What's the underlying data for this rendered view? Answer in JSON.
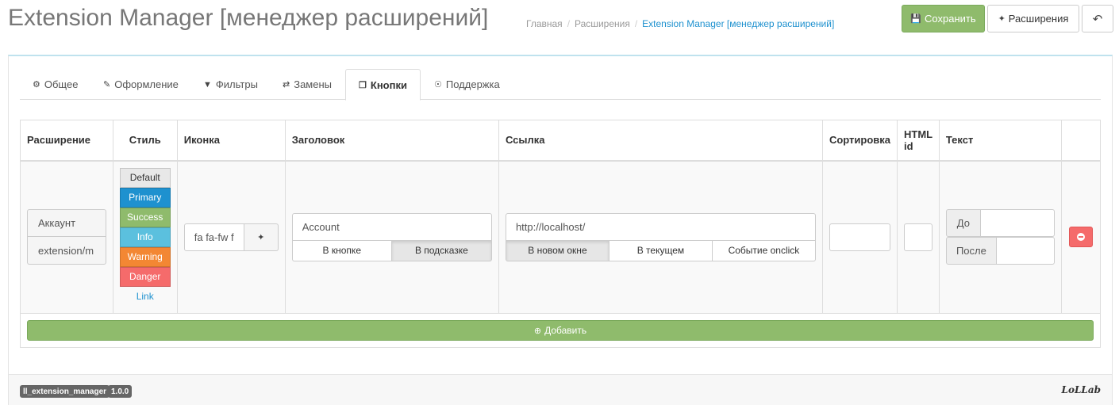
{
  "header": {
    "title": "Extension Manager [менеджер расширений]",
    "breadcrumb": [
      "Главная",
      "Расширения",
      "Extension Manager [менеджер расширений]"
    ],
    "buttons": {
      "save": "Сохранить",
      "extensions": "Расширения"
    },
    "icons": {
      "save": "floppy-icon",
      "extensions": "puzzle-icon",
      "back": "reply-icon"
    }
  },
  "tabs": [
    {
      "label": "Общее",
      "icon": "gear-icon"
    },
    {
      "label": "Оформление",
      "icon": "brush-icon"
    },
    {
      "label": "Фильтры",
      "icon": "filter-icon"
    },
    {
      "label": "Замены",
      "icon": "exchange-icon"
    },
    {
      "label": "Кнопки",
      "icon": "clone-icon",
      "active": true
    },
    {
      "label": "Поддержка",
      "icon": "lifebuoy-icon"
    }
  ],
  "table": {
    "headers": [
      "Расширение",
      "Стиль",
      "Иконка",
      "Заголовок",
      "Ссылка",
      "Сортировка",
      "HTML id",
      "Текст",
      ""
    ],
    "row": {
      "extension_name": "Аккаунт",
      "extension_route": "extension/m",
      "styles": [
        "Default",
        "Primary",
        "Success",
        "Info",
        "Warning",
        "Danger",
        "Link"
      ],
      "icon_value": "fa fa-fw f",
      "title_value": "Account",
      "title_modes": [
        "В кнопке",
        "В подсказке"
      ],
      "title_mode_selected": "В подсказке",
      "link_value": "http://localhost/",
      "link_modes": [
        "В новом окне",
        "В текущем",
        "Событие onclick"
      ],
      "link_mode_selected": "В новом окне",
      "sort_value": "",
      "html_id_value": "",
      "text_before_label": "До",
      "text_after_label": "После"
    },
    "add_button": "Добавить"
  },
  "footer": {
    "badges": [
      "ll_extension_manager",
      "1.0.0"
    ],
    "logo": "LoLLab"
  },
  "colors": {
    "success": "#8fbb6c",
    "primary": "#1e91cf",
    "danger": "#f56b6b",
    "warning": "#f38733",
    "info": "#5bc0de"
  }
}
